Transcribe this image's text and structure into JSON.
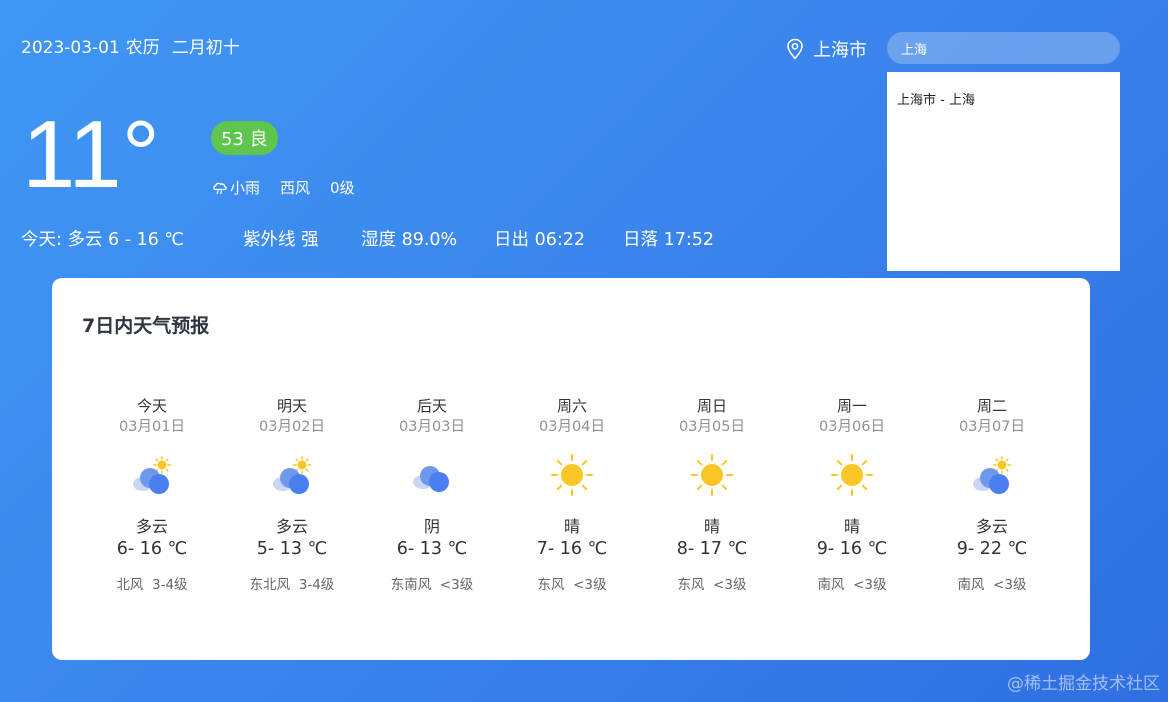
{
  "header": {
    "date": "2023-03-01",
    "lunar_label": "农历",
    "lunar_date": "二月初十",
    "location": "上海市"
  },
  "search": {
    "value": "上海",
    "results": [
      "上海市 - 上海"
    ]
  },
  "current": {
    "temperature": "11°",
    "aqi": "53 良",
    "condition": "小雨",
    "wind_direction": "西风",
    "wind_level": "0级",
    "today": "今天:  多云 6 - 16 ℃",
    "uv": "紫外线 强",
    "humidity": "湿度 89.0%",
    "sunrise": "日出 06:22",
    "sunset": "日落 17:52"
  },
  "forecast": {
    "title": "7日内天气预报",
    "days": [
      {
        "name": "今天",
        "date": "03月01日",
        "icon": "cloudy-sun-icon",
        "cond": "多云",
        "range": "6- 16 ℃",
        "wind": "北风  3-4级"
      },
      {
        "name": "明天",
        "date": "03月02日",
        "icon": "cloudy-sun-icon",
        "cond": "多云",
        "range": "5- 13 ℃",
        "wind": "东北风  3-4级"
      },
      {
        "name": "后天",
        "date": "03月03日",
        "icon": "overcast-icon",
        "cond": "阴",
        "range": "6- 13 ℃",
        "wind": "东南风  <3级"
      },
      {
        "name": "周六",
        "date": "03月04日",
        "icon": "sun-icon",
        "cond": "晴",
        "range": "7- 16 ℃",
        "wind": "东风  <3级"
      },
      {
        "name": "周日",
        "date": "03月05日",
        "icon": "sun-icon",
        "cond": "晴",
        "range": "8- 17 ℃",
        "wind": "东风  <3级"
      },
      {
        "name": "周一",
        "date": "03月06日",
        "icon": "sun-icon",
        "cond": "晴",
        "range": "9- 16 ℃",
        "wind": "南风  <3级"
      },
      {
        "name": "周二",
        "date": "03月07日",
        "icon": "cloudy-sun-icon",
        "cond": "多云",
        "range": "9- 22 ℃",
        "wind": "南风  <3级"
      }
    ]
  },
  "watermark": "@稀土掘金技术社区",
  "colors": {
    "background": "#3b86ec",
    "aqi_good": "#5ec64f",
    "sun": "#f9c623",
    "cloud_front": "#4a7ff0",
    "cloud_back": "#c9d8f2"
  }
}
